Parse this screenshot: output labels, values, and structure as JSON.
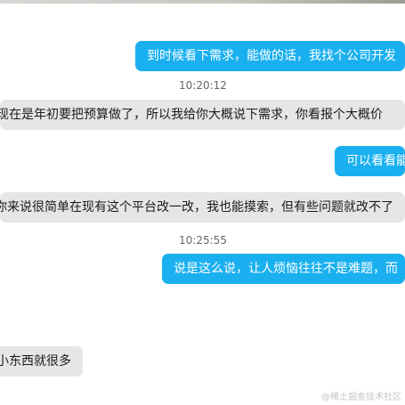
{
  "messages": [
    {
      "text": "到时候看下需求，能做的话，我找个公司开发"
    },
    {
      "text": "现在是年初要把预算做了，所以我给你大概说下需求，你看报个大概价"
    },
    {
      "text": "可以看看能"
    },
    {
      "text": "你来说很简单在现有这个平台改一改，我也能摸索，但有些问题就改不了"
    },
    {
      "text": "说是这么说，让人烦恼往往不是难题，而"
    },
    {
      "text": "小东西就很多"
    }
  ],
  "timestamps": [
    "10:20:12",
    "10:25:55"
  ],
  "watermark": "@稀土掘金技术社区"
}
